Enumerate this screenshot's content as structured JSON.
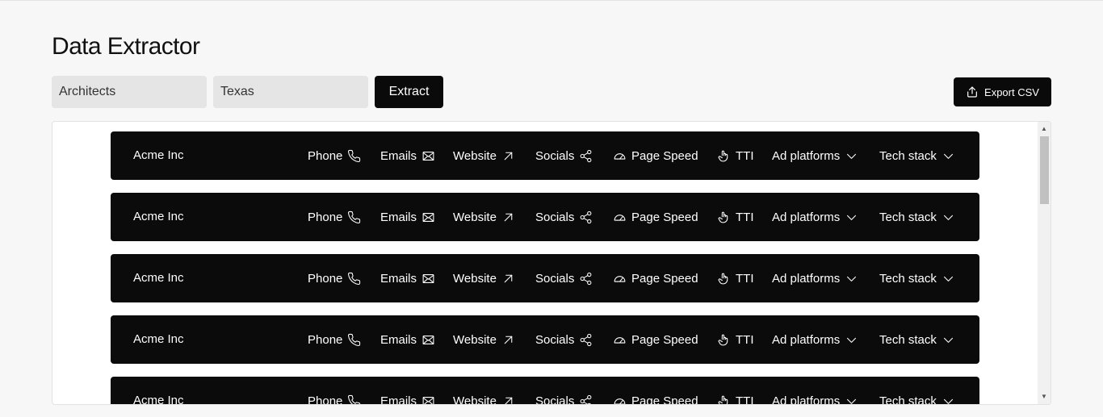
{
  "header": {
    "title": "Data Extractor"
  },
  "search": {
    "query_value": "Architects",
    "location_value": "Texas",
    "extract_label": "Extract",
    "export_label": "Export CSV"
  },
  "columns": {
    "phone": "Phone",
    "emails": "Emails",
    "website": "Website",
    "socials": "Socials",
    "page_speed": "Page Speed",
    "tti": "TTI",
    "ad_platforms": "Ad platforms",
    "tech_stack": "Tech stack"
  },
  "rows": [
    {
      "name": "Acme Inc"
    },
    {
      "name": "Acme Inc"
    },
    {
      "name": "Acme Inc"
    },
    {
      "name": "Acme Inc"
    },
    {
      "name": "Acme Inc"
    }
  ]
}
